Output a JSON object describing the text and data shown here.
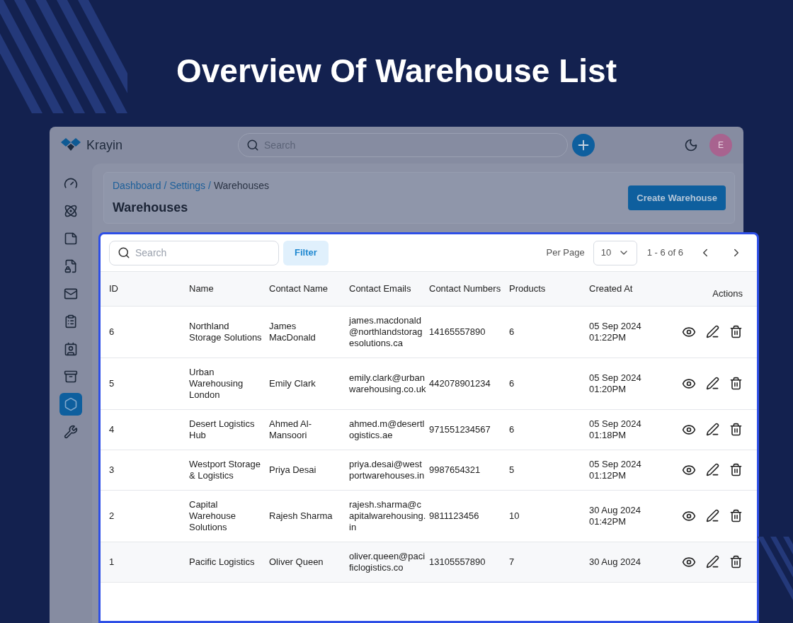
{
  "heading": "Overview Of Warehouse List",
  "app": {
    "logo": "Krayin",
    "search": {
      "placeholder": "Search"
    },
    "avatar": "E"
  },
  "sidebar": {
    "items": [
      {
        "selected": false
      },
      {
        "selected": false
      },
      {
        "selected": false
      },
      {
        "selected": false
      },
      {
        "selected": false
      },
      {
        "selected": false
      },
      {
        "selected": false
      },
      {
        "selected": false
      },
      {
        "selected": true
      },
      {
        "selected": false
      }
    ]
  },
  "breadcrumbs": [
    {
      "label": "Dashboard",
      "link": true
    },
    {
      "label": "Settings",
      "link": true
    },
    {
      "label": "Warehouses",
      "link": false
    }
  ],
  "breadcrumb_separator": "/",
  "page_title": "Warehouses",
  "create_button": "Create Warehouse",
  "toolbar": {
    "search": {
      "placeholder": "Search"
    },
    "filter": "Filter",
    "per_page_label": "Per Page",
    "per_page": "10",
    "range": "1 - 6 of 6"
  },
  "table": {
    "columns": [
      "ID",
      "Name",
      "Contact Name",
      "Contact Emails",
      "Contact Numbers",
      "Products",
      "Created At",
      "Actions"
    ],
    "rows": [
      {
        "id": "6",
        "name": "Northland Storage Solutions",
        "contact_name": "James MacDonald",
        "email": "james.macdonald@northlandstoragesolutions.ca",
        "number": "14165557890",
        "products": "6",
        "created": "05 Sep 2024 01:22PM"
      },
      {
        "id": "5",
        "name": "Urban Warehousing London",
        "contact_name": "Emily Clark",
        "email": "emily.clark@urbanwarehousing.co.uk",
        "number": "442078901234",
        "products": "6",
        "created": "05 Sep 2024 01:20PM"
      },
      {
        "id": "4",
        "name": "Desert Logistics Hub",
        "contact_name": "Ahmed Al-Mansoori",
        "email": "ahmed.m@desertlogistics.ae",
        "number": "971551234567",
        "products": "6",
        "created": "05 Sep 2024 01:18PM"
      },
      {
        "id": "3",
        "name": "Westport Storage & Logistics",
        "contact_name": "Priya Desai",
        "email": "priya.desai@westportwarehouses.in",
        "number": "9987654321",
        "products": "5",
        "created": "05 Sep 2024 01:12PM"
      },
      {
        "id": "2",
        "name": "Capital Warehouse Solutions",
        "contact_name": "Rajesh Sharma",
        "email": "rajesh.sharma@capitalwarehousing.in",
        "number": "9811123456",
        "products": "10",
        "created": "30 Aug 2024 01:42PM"
      },
      {
        "id": "1",
        "name": "Pacific Logistics",
        "contact_name": "Oliver Queen",
        "email": "oliver.queen@pacificlogistics.co",
        "number": "13105557890",
        "products": "7",
        "created": "30 Aug 2024"
      }
    ]
  }
}
